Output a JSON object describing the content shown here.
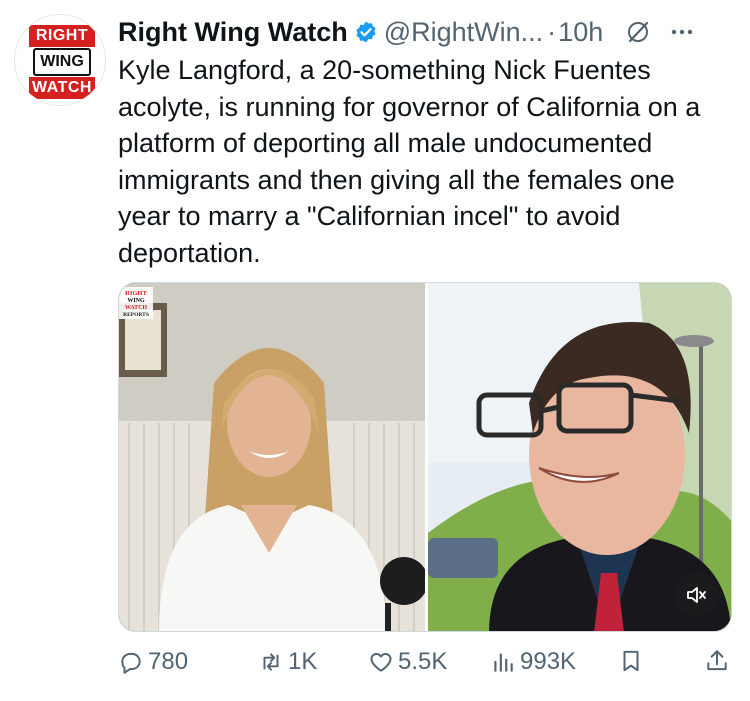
{
  "account": {
    "display_name": "Right Wing Watch",
    "handle": "@RightWin...",
    "separator": "·",
    "time": "10h",
    "avatar_text": [
      "RIGHT",
      "WING",
      "WATCH"
    ]
  },
  "tweet": {
    "text": "Kyle Langford, a 20-something Nick Fuentes acolyte, is running for governor of California on a platform of deporting all male undocumented immigrants and then giving all the females one year to marry a \"Californian incel\" to avoid deportation."
  },
  "media": {
    "watermark": [
      "RIGHT",
      "WING",
      "WATCH",
      "REPORTS"
    ]
  },
  "actions": {
    "replies": "780",
    "reposts": "1K",
    "likes": "5.5K",
    "views": "993K"
  },
  "colors": {
    "brand_red": "#d4201f",
    "verified_blue": "#1d9bf0",
    "secondary_text": "#536471"
  }
}
